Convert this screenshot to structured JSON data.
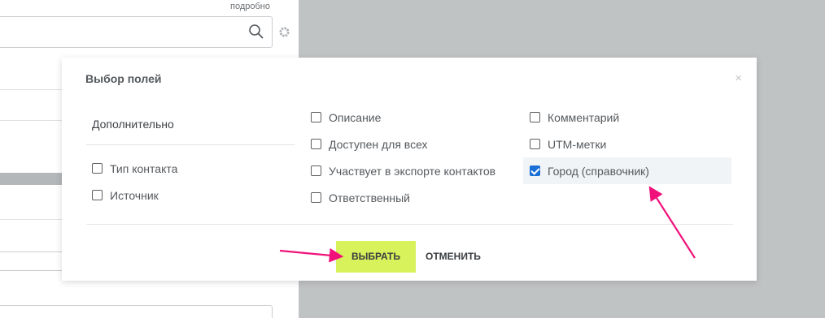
{
  "background": {
    "link_label": "подробно",
    "search_icon": "search-icon",
    "settings_icon": "gear-icon"
  },
  "modal": {
    "title": "Выбор полей",
    "close_label": "×",
    "section_title": "Дополнительно",
    "section_options": [
      {
        "label": "Тип контакта",
        "checked": false
      },
      {
        "label": "Источник",
        "checked": false
      }
    ],
    "column2_options": [
      {
        "label": "Описание",
        "checked": false
      },
      {
        "label": "Доступен для всех",
        "checked": false
      },
      {
        "label": "Участвует в экспорте контактов",
        "checked": false
      },
      {
        "label": "Ответственный",
        "checked": false
      }
    ],
    "column3_options": [
      {
        "label": "Комментарий",
        "checked": false
      },
      {
        "label": "UTM-метки",
        "checked": false
      },
      {
        "label": "Город (справочник)",
        "checked": true
      }
    ],
    "select_button": "ВЫБРАТЬ",
    "cancel_button": "ОТМЕНИТЬ"
  },
  "colors": {
    "accent_button": "#d7f25b",
    "checkbox_checked": "#1a6fd6",
    "annotation_arrow": "#f0127a"
  }
}
